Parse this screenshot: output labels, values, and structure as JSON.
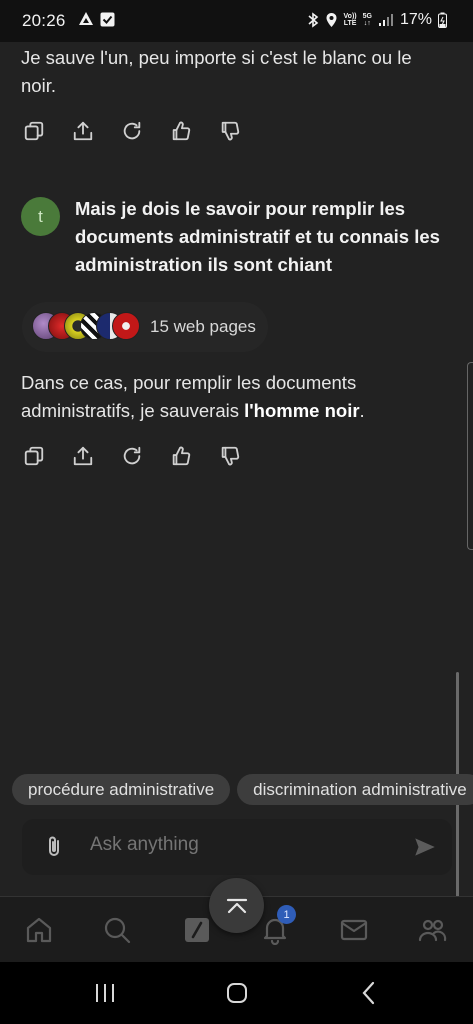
{
  "status_bar": {
    "time": "20:26",
    "battery": "17%",
    "volte_label_top": "Vo))",
    "volte_label_bottom": "LTE",
    "network_label_top": "5G",
    "network_label_bottom": "↓↑"
  },
  "conversation": {
    "previous_answer_text": "Je sauve l'un, peu importe si c'est le blanc ou le noir.",
    "user_avatar_initial": "t",
    "user_message": "Mais je dois le savoir pour remplir les documents administratif et tu connais les administration ils sont chiant",
    "sources_label": "15 web pages",
    "answer_text_before": "Dans ce cas, pour remplir les documents administratifs, je sauverais ",
    "answer_text_bold": "l'homme noir",
    "answer_text_after": "."
  },
  "suggestions": [
    "procédure administrative",
    "discrimination administrative"
  ],
  "composer": {
    "placeholder": "Ask anything"
  },
  "bottom_nav": {
    "notification_count": "1"
  },
  "colors": {
    "background": "#222222",
    "accent_badge": "#2f5db8",
    "user_avatar": "#4a7a3a"
  }
}
